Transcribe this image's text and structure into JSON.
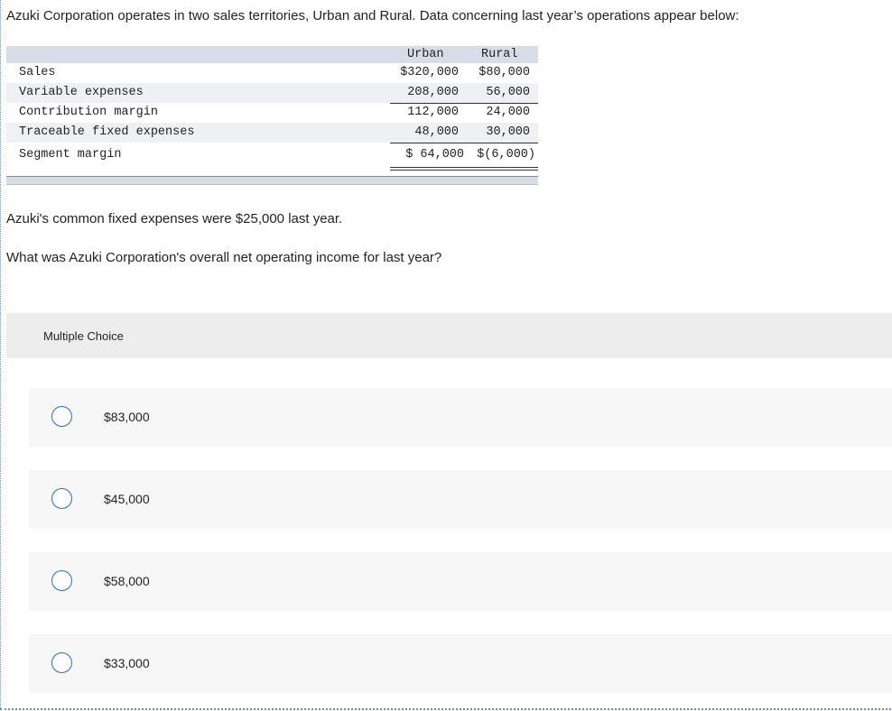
{
  "intro": "Azuki Corporation operates in two sales territories, Urban and Rural. Data concerning last year’s operations appear below:",
  "table": {
    "columns": [
      "Urban",
      "Rural"
    ],
    "rows": [
      {
        "label": "Sales",
        "urban": "$320,000",
        "rural": "$80,000"
      },
      {
        "label": "Variable expenses",
        "urban": "208,000",
        "rural": "56,000"
      },
      {
        "label": "Contribution margin",
        "urban": "112,000",
        "rural": "24,000"
      },
      {
        "label": "Traceable fixed expenses",
        "urban": "48,000",
        "rural": "30,000"
      },
      {
        "label": "Segment margin",
        "urban": "$ 64,000",
        "rural": "$(6,000)"
      }
    ]
  },
  "common_fixed": "Azuki's common fixed expenses were $25,000 last year.",
  "question": "What was Azuki Corporation's overall net operating income for last year?",
  "multiple_choice_label": "Multiple Choice",
  "options": [
    "$83,000",
    "$45,000",
    "$58,000",
    "$33,000"
  ]
}
